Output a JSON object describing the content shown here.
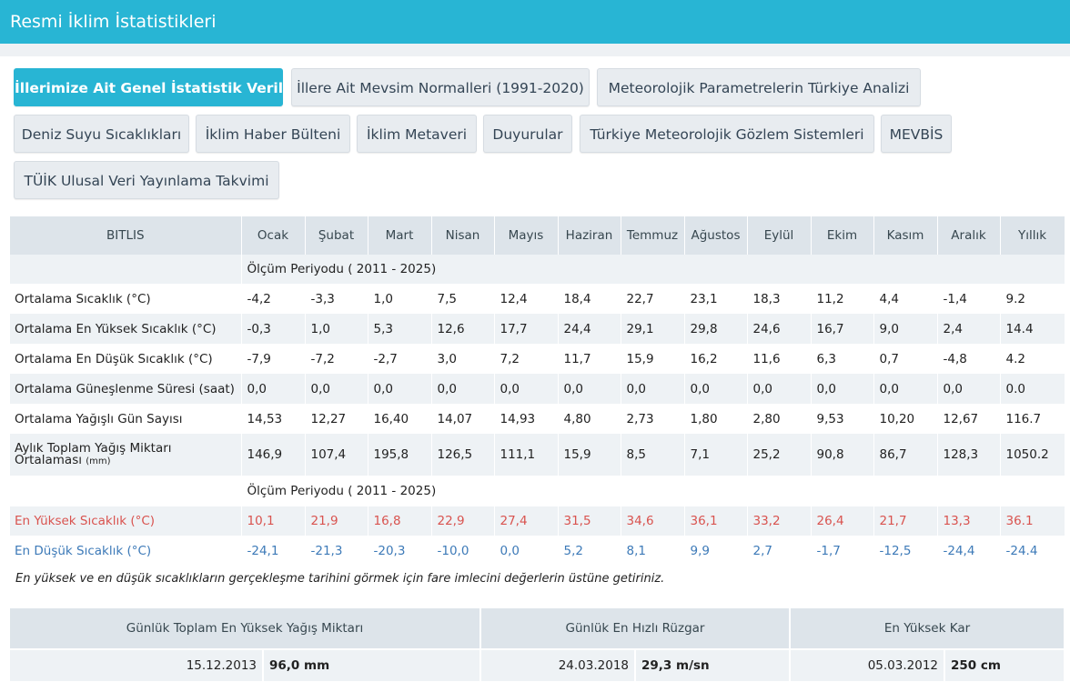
{
  "header": {
    "title": "Resmi İklim İstatistikleri"
  },
  "nav": {
    "tabs": [
      "İllerimize Ait Genel İstatistik Verileri",
      "İllere Ait Mevsim Normalleri (1991-2020)",
      "Meteorolojik Parametrelerin Türkiye Analizi",
      "Deniz Suyu Sıcaklıkları",
      "İklim Haber Bülteni",
      "İklim Metaveri",
      "Duyurular",
      "Türkiye Meteorolojik Gözlem Sistemleri",
      "MEVBİS",
      "TÜİK Ulusal Veri Yayınlama Takvimi"
    ]
  },
  "table": {
    "station": "BITLIS",
    "months": [
      "Ocak",
      "Şubat",
      "Mart",
      "Nisan",
      "Mayıs",
      "Haziran",
      "Temmuz",
      "Ağustos",
      "Eylül",
      "Ekim",
      "Kasım",
      "Aralık",
      "Yıllık"
    ],
    "period1": "Ölçüm Periyodu ( 2011 - 2025)",
    "rows": [
      {
        "label": "Ortalama Sıcaklık (°C)",
        "values": [
          "-4,2",
          "-3,3",
          "1,0",
          "7,5",
          "12,4",
          "18,4",
          "22,7",
          "23,1",
          "18,3",
          "11,2",
          "4,4",
          "-1,4",
          "9.2"
        ]
      },
      {
        "label": "Ortalama En Yüksek Sıcaklık (°C)",
        "values": [
          "-0,3",
          "1,0",
          "5,3",
          "12,6",
          "17,7",
          "24,4",
          "29,1",
          "29,8",
          "24,6",
          "16,7",
          "9,0",
          "2,4",
          "14.4"
        ]
      },
      {
        "label": "Ortalama En Düşük Sıcaklık (°C)",
        "values": [
          "-7,9",
          "-7,2",
          "-2,7",
          "3,0",
          "7,2",
          "11,7",
          "15,9",
          "16,2",
          "11,6",
          "6,3",
          "0,7",
          "-4,8",
          "4.2"
        ]
      },
      {
        "label": "Ortalama Güneşlenme Süresi (saat)",
        "values": [
          "0,0",
          "0,0",
          "0,0",
          "0,0",
          "0,0",
          "0,0",
          "0,0",
          "0,0",
          "0,0",
          "0,0",
          "0,0",
          "0,0",
          "0.0"
        ]
      },
      {
        "label": "Ortalama Yağışlı Gün Sayısı",
        "values": [
          "14,53",
          "12,27",
          "16,40",
          "14,07",
          "14,93",
          "4,80",
          "2,73",
          "1,80",
          "2,80",
          "9,53",
          "10,20",
          "12,67",
          "116.7"
        ]
      }
    ],
    "rain_row": {
      "label_line1": "Aylık Toplam Yağış Miktarı",
      "label_line2": "Ortalaması",
      "label_unit": "(mm)",
      "values": [
        "146,9",
        "107,4",
        "195,8",
        "126,5",
        "111,1",
        "15,9",
        "8,5",
        "7,1",
        "25,2",
        "90,8",
        "86,7",
        "128,3",
        "1050.2"
      ]
    },
    "period2": "Ölçüm Periyodu ( 2011 - 2025)",
    "max_row": {
      "label": "En Yüksek Sıcaklık (°C)",
      "values": [
        "10,1",
        "21,9",
        "16,8",
        "22,9",
        "27,4",
        "31,5",
        "34,6",
        "36,1",
        "33,2",
        "26,4",
        "21,7",
        "13,3",
        "36.1"
      ]
    },
    "min_row": {
      "label": "En Düşük Sıcaklık (°C)",
      "values": [
        "-24,1",
        "-21,3",
        "-20,3",
        "-10,0",
        "0,0",
        "5,2",
        "8,1",
        "9,9",
        "2,7",
        "-1,7",
        "-12,5",
        "-24,4",
        "-24.4"
      ]
    }
  },
  "note": "En yüksek ve en düşük sıcaklıkların gerçekleşme tarihini görmek için fare imlecini değerlerin üstüne getiriniz.",
  "extremes": {
    "headers": [
      "Günlük Toplam En Yüksek Yağış Miktarı",
      "Günlük En Hızlı Rüzgar",
      "En Yüksek Kar"
    ],
    "dates": [
      "15.12.2013",
      "24.03.2018",
      "05.03.2012"
    ],
    "values": [
      "96,0 mm",
      "29,3 m/sn",
      "250 cm"
    ]
  },
  "colors": {
    "accent": "#28b5d4",
    "max_red": "#d9534f",
    "min_blue": "#3d7ab8"
  }
}
